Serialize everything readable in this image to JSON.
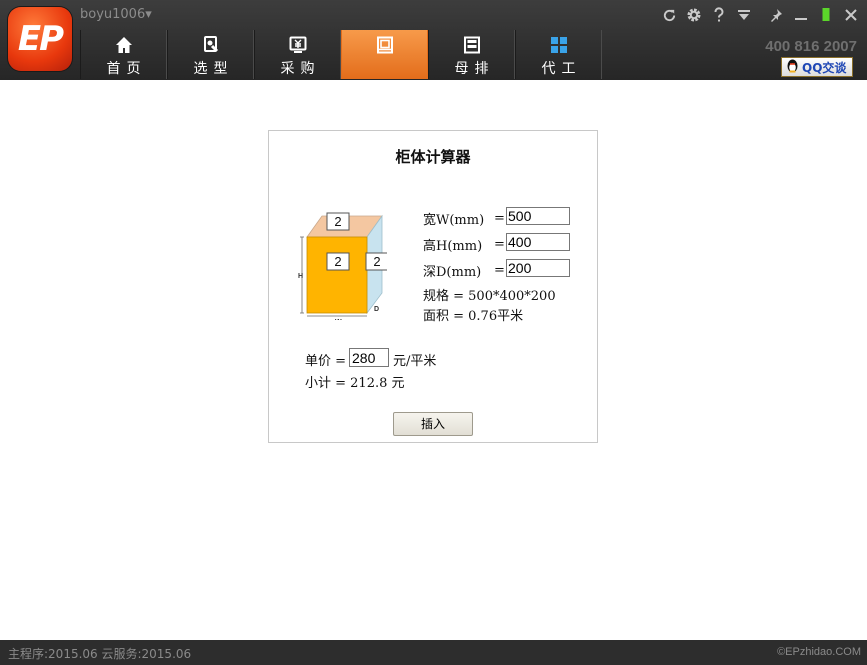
{
  "app": {
    "logo_text": "EP",
    "user_menu": "boyu1006▾",
    "hotline": "400 816 2007",
    "qq_label": "QQ交谈",
    "icons": [
      "refresh-icon",
      "settings-icon",
      "help-icon",
      "dropdown-icon",
      "pin-icon",
      "minimize-icon",
      "restore-icon",
      "close-icon"
    ]
  },
  "nav": {
    "items": [
      {
        "label": "首页",
        "icon": "home-icon"
      },
      {
        "label": "选型",
        "icon": "select-icon"
      },
      {
        "label": "采购",
        "icon": "purchase-icon"
      },
      {
        "label": "",
        "icon": "cabinet-icon",
        "active": true
      },
      {
        "label": "母排",
        "icon": "busbar-icon"
      },
      {
        "label": "代工",
        "icon": "grid-icon"
      }
    ]
  },
  "calculator": {
    "title": "柜体计算器",
    "diagram": {
      "top_count": "2",
      "front_count": "2",
      "side_count": "2",
      "h_label": "H",
      "w_label": "W",
      "d_label": "D"
    },
    "width_label": "宽W(mm)",
    "height_label": "高H(mm)",
    "depth_label": "深D(mm)",
    "eq": "=",
    "width_value": "500",
    "height_value": "400",
    "depth_value": "200",
    "spec_line": "规格 = 500*400*200",
    "area_line": "面积 = 0.76平米",
    "price_label": "单价 =",
    "price_value": "280",
    "price_unit": "元/平米",
    "subtotal_line": "小计 = 212.8 元",
    "insert_label": "插入"
  },
  "status": {
    "left": "主程序:2015.06  云服务:2015.06",
    "right": "©EPzhidao.COM"
  },
  "colors": {
    "accent": "#e8741f",
    "box_front": "#ffb400",
    "box_top": "#f4c7a1",
    "box_side": "#c8e3ef"
  }
}
